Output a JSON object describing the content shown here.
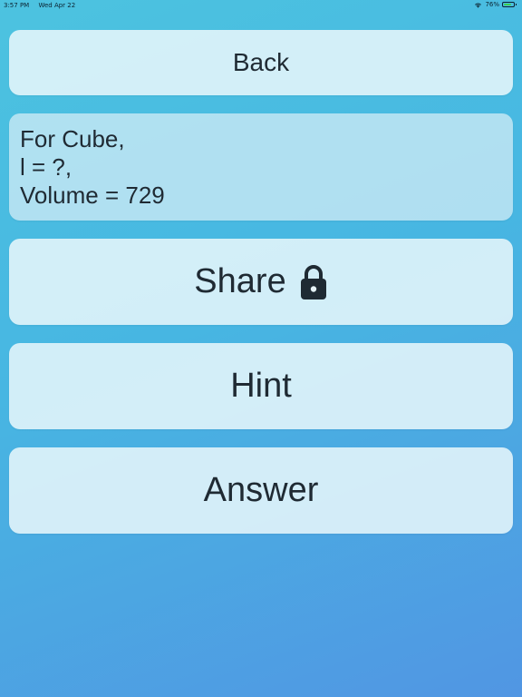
{
  "status_bar": {
    "time": "3:57 PM",
    "date": "Wed Apr 22",
    "battery_percent": "76%",
    "battery_level": 0.76
  },
  "buttons": {
    "back_label": "Back",
    "share_label": "Share",
    "hint_label": "Hint",
    "answer_label": "Answer"
  },
  "question": {
    "line1": "For Cube,",
    "line2": "l = ?,",
    "line3": "Volume = 729"
  },
  "icons": {
    "share_lock": "lock-icon",
    "wifi": "wifi-icon",
    "battery": "battery-icon"
  }
}
